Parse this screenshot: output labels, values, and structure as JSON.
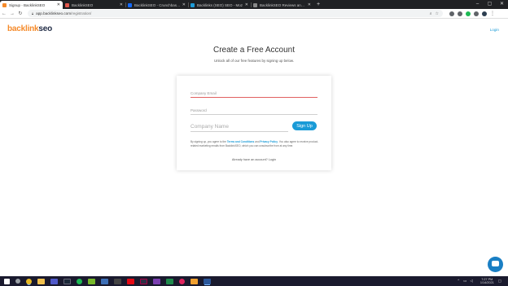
{
  "browser": {
    "tabs": [
      {
        "title": "Signup - BacklinkSEO",
        "active": true,
        "favicon_color": "#f58a2a"
      },
      {
        "title": "BacklinkSEO",
        "active": false,
        "favicon_color": "#e2574c"
      },
      {
        "title": "BacklinkSEO - Crunchbase Comp...",
        "active": false,
        "favicon_color": "#146aff"
      },
      {
        "title": "Backlinks (SEO) SEO - Moz",
        "active": false,
        "favicon_color": "#1d9bd7"
      },
      {
        "title": "BacklinkSEO Reviews and Pricing...",
        "active": false,
        "favicon_color": "#888888"
      }
    ],
    "new_tab": "+",
    "window_controls": {
      "minimize": "–",
      "maximize": "▢",
      "close": "✕"
    },
    "address": {
      "host": "app.backlinkseo.com",
      "path": "/registration/"
    }
  },
  "header": {
    "logo_part1": "backlink",
    "logo_part2": "seo",
    "login_link": "Login"
  },
  "main": {
    "title": "Create a Free Account",
    "subtitle": "Unlock all of our free features by signing up below.",
    "form": {
      "email_placeholder": "Company Email",
      "password_placeholder": "Password",
      "company_placeholder": "Company Name",
      "signup_button": "Sign Up",
      "terms_prefix": "By signing up, you agree to the ",
      "terms_link": "Terms and Conditions",
      "terms_and": " and ",
      "privacy_link": "Privacy Policy",
      "terms_suffix": ". You also agree to receive product-related marketing emails from BacklinkSEO, which you can unsubscribe from at any time.",
      "already_text": "Already have an account? Login"
    }
  },
  "taskbar": {
    "time": "7:27 PM",
    "date": "1/14/2021"
  },
  "colors": {
    "brand_orange": "#f58a2a",
    "brand_navy": "#1f2a44",
    "accent_blue": "#1a9bd7"
  }
}
